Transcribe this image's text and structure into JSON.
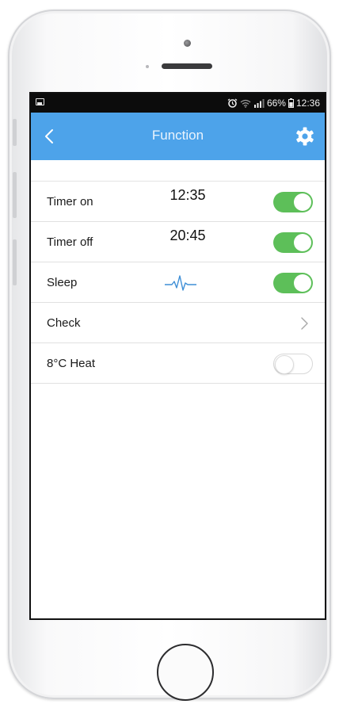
{
  "status_bar": {
    "battery": "66%",
    "time": "12:36"
  },
  "header": {
    "title": "Function"
  },
  "rows": [
    {
      "label": "Timer on",
      "value": "12:35",
      "control": "toggle",
      "on": true
    },
    {
      "label": "Timer off",
      "value": "20:45",
      "control": "toggle",
      "on": true
    },
    {
      "label": "Sleep",
      "icon": "pulse-icon",
      "control": "toggle",
      "on": true
    },
    {
      "label": "Check",
      "control": "chevron-right-icon"
    },
    {
      "label": "8°C Heat",
      "control": "toggle",
      "on": false
    }
  ],
  "colors": {
    "header": "#4da3ea",
    "toggle_on": "#5dbf59",
    "pulse": "#3f8fd6"
  }
}
